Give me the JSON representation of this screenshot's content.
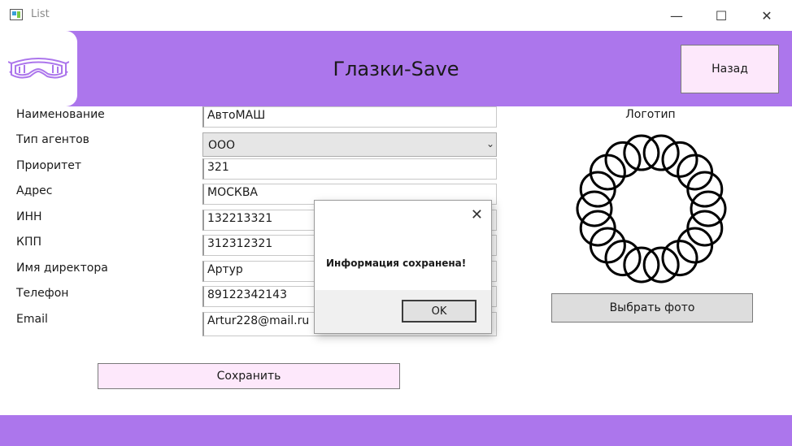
{
  "window": {
    "title": "List",
    "minimize_glyph": "—",
    "maximize_glyph": "☐",
    "close_glyph": "✕"
  },
  "header": {
    "title": "Глазки-Save",
    "back_label": "Назад",
    "logo_icon": "goggles-icon"
  },
  "form": {
    "fields": [
      {
        "label": "Наименование",
        "value": "АвтоМАШ"
      },
      {
        "label": "Тип агентов",
        "value": "ООО"
      },
      {
        "label": "Приоритет",
        "value": "321"
      },
      {
        "label": "Адрес",
        "value": "МОСКВА"
      },
      {
        "label": "ИНН",
        "value": "132213321"
      },
      {
        "label": "КПП",
        "value": "312312321"
      },
      {
        "label": "Имя директора",
        "value": "Артур"
      },
      {
        "label": "Телефон",
        "value": "89122342143"
      },
      {
        "label": "Email",
        "value": "Artur228@mail.ru"
      }
    ],
    "save_label": "Сохранить"
  },
  "logo_panel": {
    "label": "Логотип",
    "choose_photo_label": "Выбрать фото",
    "image_icon": "ring-circle-logo"
  },
  "dialog": {
    "message": "Информация сохранена!",
    "ok_label": "OK",
    "close_glyph": "✕"
  },
  "colors": {
    "accent": "#ac76ec",
    "button_pink": "#fde8fb"
  }
}
